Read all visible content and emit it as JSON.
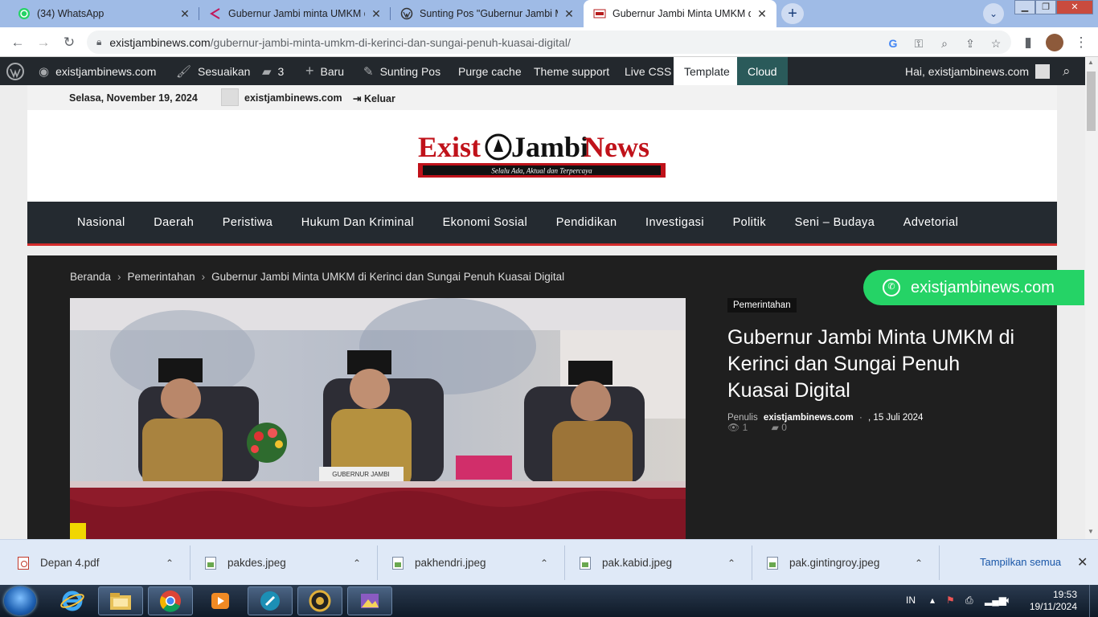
{
  "browser": {
    "tabs": [
      {
        "title": "(34) WhatsApp",
        "icon": "whatsapp-icon"
      },
      {
        "title": "Gubernur Jambi minta UMKM di Kerinci",
        "icon": "wp-admin-icon"
      },
      {
        "title": "Sunting Pos \"Gubernur Jambi Minta",
        "icon": "wordpress-icon"
      },
      {
        "title": "Gubernur Jambi Minta UMKM di Kerinci",
        "icon": "site-favicon-icon"
      }
    ],
    "url_host": "existjambinews.com",
    "url_path": "/gubernur-jambi-minta-umkm-di-kerinci-dan-sungai-penuh-kuasai-digital/"
  },
  "wp_admin_bar": {
    "site": "existjambinews.com",
    "customize": "Sesuaikan",
    "comments_count": "3",
    "new": "Baru",
    "edit_post": "Sunting Pos",
    "purge": "Purge cache",
    "theme_support": "Theme support",
    "live_css": "Live CSS",
    "template": "Template",
    "cloud": "Cloud",
    "greeting": "Hai, existjambinews.com"
  },
  "site": {
    "date": "Selasa, November 19, 2024",
    "user": "existjambinews.com",
    "logout": "Keluar",
    "logo_part1": "Exist",
    "logo_part2": "Jambi",
    "logo_part3": "News",
    "tagline": "Selalu Ada, Aktual dan Terpercaya",
    "nav": [
      "Nasional",
      "Daerah",
      "Peristiwa",
      "Hukum Dan Kriminal",
      "Ekonomi Sosial",
      "Pendidikan",
      "Investigasi",
      "Politik",
      "Seni – Budaya",
      "Advetorial"
    ]
  },
  "article": {
    "breadcrumb": [
      "Beranda",
      "Pemerintahan",
      "Gubernur Jambi Minta UMKM di Kerinci dan Sungai Penuh Kuasai Digital"
    ],
    "category": "Pemerintahan",
    "title": "Gubernur Jambi Minta UMKM di Kerinci dan Sungai Penuh Kuasai Digital",
    "author_label": "Penulis",
    "author": "existjambinews.com",
    "date": ", 15 Juli 2024",
    "views": "1",
    "comments": "0",
    "photo_caption_sign": "GUBERNUR JAMBI"
  },
  "whatsapp_button": "existjambinews.com",
  "downloads": [
    {
      "name": "Depan 4.pdf",
      "type": "pdf"
    },
    {
      "name": "pakdes.jpeg",
      "type": "img"
    },
    {
      "name": "pakhendri.jpeg",
      "type": "img"
    },
    {
      "name": "pak.kabid.jpeg",
      "type": "img"
    },
    {
      "name": "pak.gintingroy.jpeg",
      "type": "img"
    }
  ],
  "downloads_show_all": "Tampilkan semua",
  "taskbar": {
    "lang": "IN",
    "time": "19:53",
    "date": "19/11/2024"
  },
  "colors": {
    "accent_red": "#d32b2b",
    "nav_bg": "#242a30",
    "whatsapp_green": "#25d366",
    "wp_bar": "#23282d"
  }
}
